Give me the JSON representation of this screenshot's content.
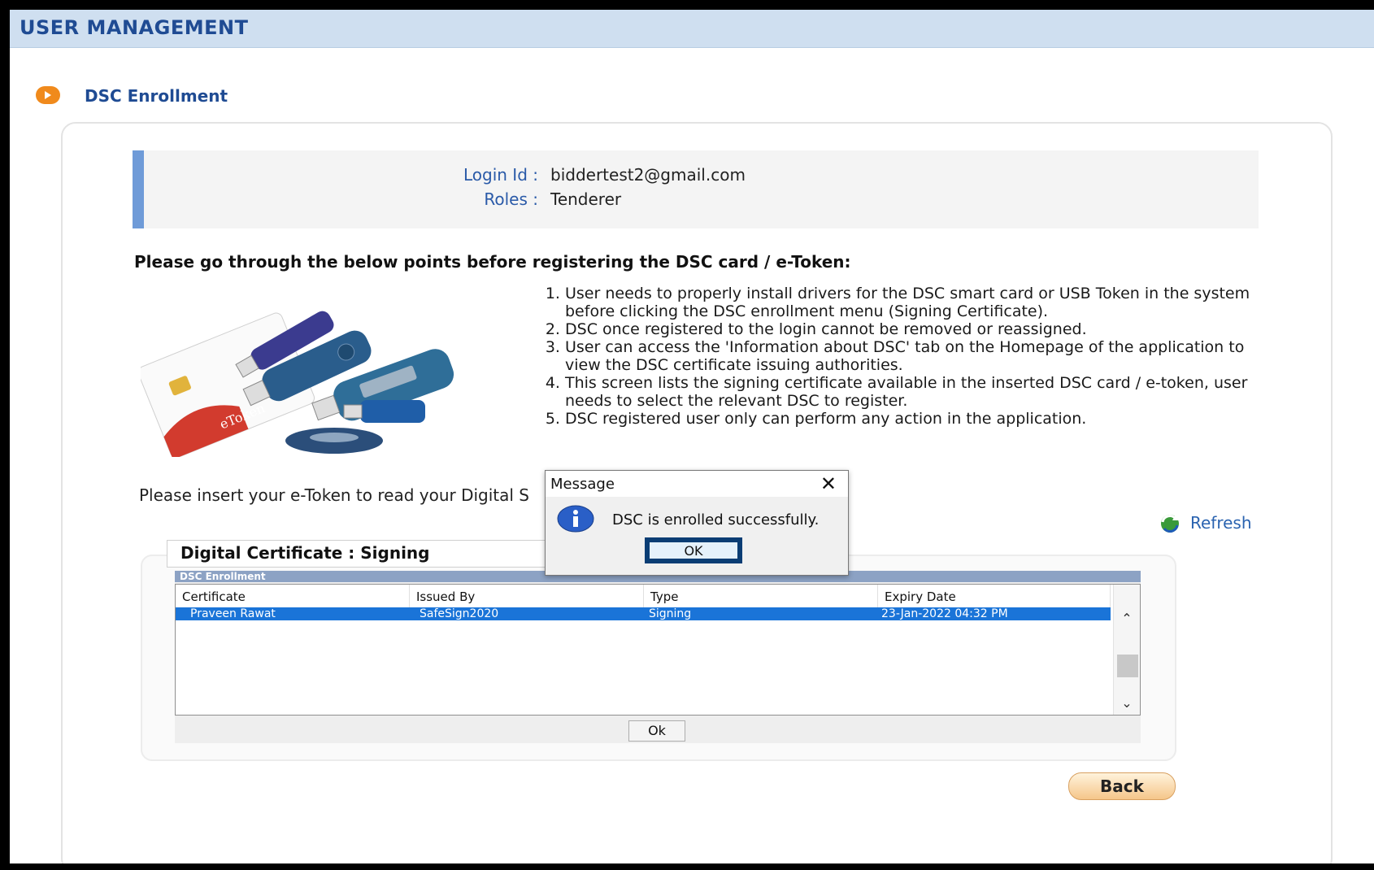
{
  "header": {
    "title": "USER MANAGEMENT"
  },
  "section": {
    "title": "DSC Enrollment",
    "icon": "orange-arrow-icon"
  },
  "user": {
    "login_label": "Login Id :",
    "login_value": "biddertest2@gmail.com",
    "roles_label": "Roles :",
    "roles_value": "Tenderer"
  },
  "instructions": {
    "heading": "Please go through the below points before registering the DSC card / e-Token:",
    "points": [
      "User needs to properly install drivers for the DSC smart card or USB Token in the system before clicking the DSC enrollment menu (Signing Certificate).",
      "DSC once registered to the login cannot be removed or reassigned.",
      "User can access the 'Information about DSC' tab on the Homepage of the application to view the DSC certificate issuing authorities.",
      "This screen lists the signing certificate available in the inserted DSC card / e-token, user needs to select the relevant DSC to register.",
      "DSC registered user only can perform any action in the application."
    ]
  },
  "insert_text": "Please insert your e-Token to read your Digital S",
  "refresh_label": "Refresh",
  "cert_panel": {
    "tab_label": "Digital Certificate : Signing",
    "applet_title": "DSC Enrollment",
    "columns": [
      "Certificate",
      "Issued By",
      "Type",
      "Expiry Date"
    ],
    "rows": [
      [
        "Praveen Rawat",
        "SafeSign2020",
        "Signing",
        "23-Jan-2022 04:32 PM"
      ]
    ],
    "ok_label": "Ok"
  },
  "back_label": "Back",
  "dialog": {
    "title": "Message",
    "message": "DSC is enrolled successfully.",
    "ok_label": "OK"
  },
  "colors": {
    "header_bg": "#cfdff0",
    "header_text": "#1f4b93",
    "selection": "#1a74d8",
    "accent_orange": "#f08a1c"
  }
}
